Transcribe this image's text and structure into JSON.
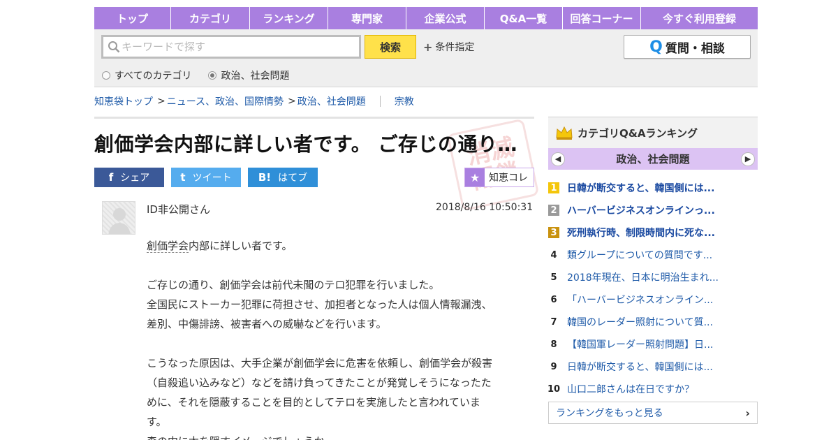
{
  "nav": [
    "トップ",
    "カテゴリ",
    "ランキング",
    "専門家",
    "企業公式",
    "Q&A一覧",
    "回答コーナー",
    "今すぐ利用登録"
  ],
  "search": {
    "placeholder": "キーワードで探す",
    "button": "検索",
    "conditions": "条件指定",
    "ask_label": "質問・相談",
    "ask_icon": "Q",
    "scopes": [
      "すべてのカテゴリ",
      "政治、社会問題"
    ],
    "selected_scope": "政治、社会問題"
  },
  "breadcrumb": {
    "home": "知恵袋トップ",
    "level1": "ニュース、政治、国際情勢",
    "level2": "政治、社会問題",
    "tag": "宗教",
    "separator": ">"
  },
  "question": {
    "title": "創価学会内部に詳しい者です。 ご存じの通り…",
    "user": "ID非公開さん",
    "datetime": "2018/8/16  10:50:31",
    "keyword": "創価学会",
    "body_first_rest": "内部に詳しい者です。",
    "body": [
      "ご存じの通り、創価学会は前代未聞のテロ犯罪を行いました。",
      "全国民にストーカー犯罪に荷担させ、加担者となった人は個人情報漏洩、",
      "差別、中傷誹謗、被害者への威嚇などを行います。",
      "",
      "こうなった原因は、大手企業が創価学会に危害を依頼し、創価学会が殺害",
      "（自殺追い込みなど）などを請け負ってきたことが発覚しそうになったた",
      "めに、それを隠蔽することを目的としてテロを実施したと言われていま",
      "す。",
      "森の中に木を隠すイメージでしょうか。"
    ],
    "stamp_text": "消滅\n閉鎖"
  },
  "share": {
    "facebook": "シェア",
    "facebook_mark": "f",
    "twitter": "ツイート",
    "twitter_mark": "t",
    "hatena": "はてブ",
    "hatena_mark": "B!",
    "favorite": "知恵コレ"
  },
  "ranking": {
    "title": "カテゴリQ&Aランキング",
    "category": "政治、社会問題",
    "items": [
      {
        "rank": "1",
        "text": "日韓が断交すると、韓国側には..."
      },
      {
        "rank": "2",
        "text": "ハーバービジネスオンラインっ..."
      },
      {
        "rank": "3",
        "text": "死刑執行時、制限時間内に死な..."
      },
      {
        "rank": "4",
        "text": "類グループについての質問です..."
      },
      {
        "rank": "5",
        "text": "2018年現在、日本に明治生まれ..."
      },
      {
        "rank": "6",
        "text": "「ハーバービジネスオンライン..."
      },
      {
        "rank": "7",
        "text": "韓国のレーダー照射について質..."
      },
      {
        "rank": "8",
        "text": "【韓国軍レーダー照射問題】日..."
      },
      {
        "rank": "9",
        "text": "日韓が断交すると、韓国側には..."
      },
      {
        "rank": "10",
        "text": "山口二郎さんは在日ですか？"
      }
    ],
    "more": "ランキングをもっと見る"
  },
  "colors": {
    "nav": "#a97fe0",
    "search_button": "#ffe14a",
    "link": "#1e5aa8",
    "category_band": "#dcc3f3"
  },
  "icons": {
    "search": "search-icon",
    "plus": "plus-icon",
    "crown": "crown-icon",
    "star": "star-icon",
    "prev": "chevron-left-icon",
    "next": "chevron-right-icon"
  }
}
